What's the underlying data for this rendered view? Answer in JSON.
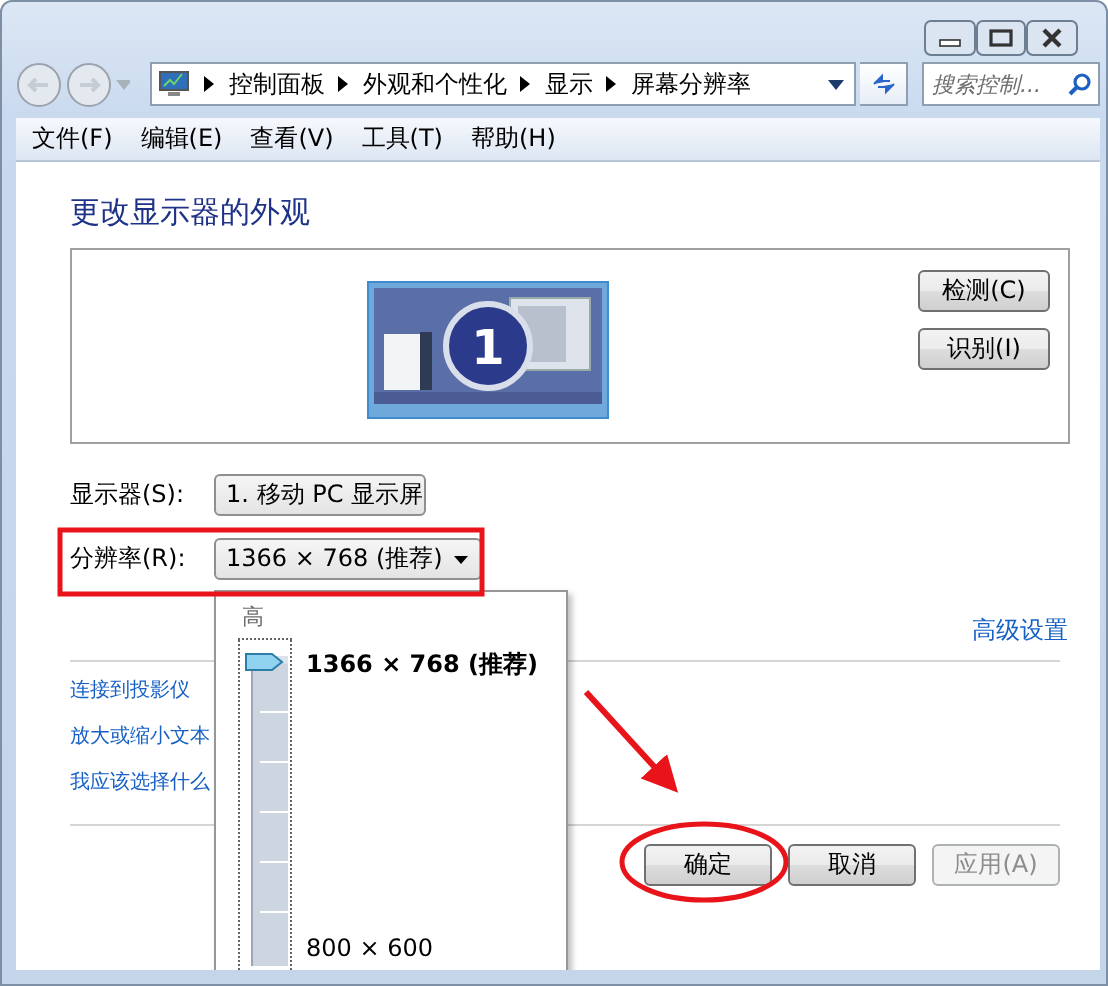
{
  "address_bar": {
    "breadcrumbs": [
      "控制面板",
      "外观和个性化",
      "显示",
      "屏幕分辨率"
    ]
  },
  "search": {
    "placeholder": "搜索控制..."
  },
  "menu": [
    "文件(F)",
    "编辑(E)",
    "查看(V)",
    "工具(T)",
    "帮助(H)"
  ],
  "heading": "更改显示器的外观",
  "preview": {
    "monitor_number": "1",
    "buttons": [
      "检测(C)",
      "识别(I)"
    ]
  },
  "settings": [
    {
      "label": "显示器(S):",
      "value": "1. 移动 PC 显示屏"
    },
    {
      "label": "分辨率(R):",
      "value": "1366 × 768 (推荐)"
    }
  ],
  "resolution_popup": {
    "high_label": "高",
    "level": 1,
    "top_option": "1366 × 768 (推荐)",
    "bottom_option": "800 × 600"
  },
  "advanced_link": "高级设置",
  "links": [
    "连接到投影仪",
    "放大或缩小文本",
    "我应该选择什么"
  ],
  "footer_buttons": [
    {
      "label": "确定",
      "disabled": false
    },
    {
      "label": "取消",
      "disabled": false
    },
    {
      "label": "应用(A)",
      "disabled": true
    }
  ]
}
